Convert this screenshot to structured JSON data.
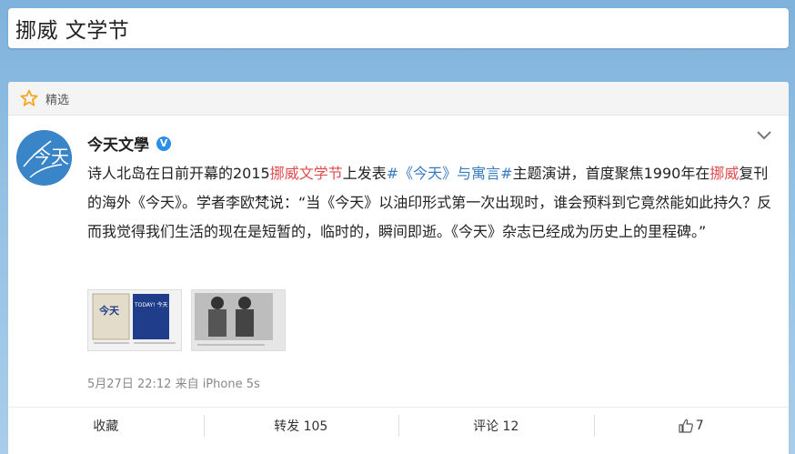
{
  "search": {
    "query": "挪威 文学节"
  },
  "card": {
    "header_label": "精选"
  },
  "post": {
    "author": "今天文學",
    "avatar_text": "今天",
    "verified_badge": "V",
    "segments": [
      {
        "text": "诗人北岛在日前开幕的2015",
        "style": "normal"
      },
      {
        "text": "挪威文学节",
        "style": "highlight"
      },
      {
        "text": "上发表",
        "style": "normal"
      },
      {
        "text": "#《今天》与寓言#",
        "style": "link"
      },
      {
        "text": "主题演讲，首度聚焦1990年在",
        "style": "normal"
      },
      {
        "text": "挪威",
        "style": "highlight"
      },
      {
        "text": "复刊的海外《今天》。学者李欧梵说：“当《今天》以油印形式第一次出现时，谁会预料到它竟然能如此持久？反而我觉得我们生活的现在是短暂的，临时的，瞬间即逝。《今天》杂志已经成为历史上的里程碑。”",
        "style": "normal"
      }
    ],
    "images": [
      {
        "name": "magazine-covers-image",
        "title_left": "今天",
        "title_right": "TODAY! 今天"
      },
      {
        "name": "archive-photo-image"
      }
    ],
    "timestamp": "5月27日 22:12",
    "source": "来自 iPhone 5s"
  },
  "actions": {
    "favorite": "收藏",
    "repost": "转发 105",
    "comment": "评论 12",
    "like": "7"
  },
  "colors": {
    "highlight": "#e04c4c",
    "link": "#3a7abf",
    "verified": "#2b8ee8",
    "star": "#f5a623"
  }
}
